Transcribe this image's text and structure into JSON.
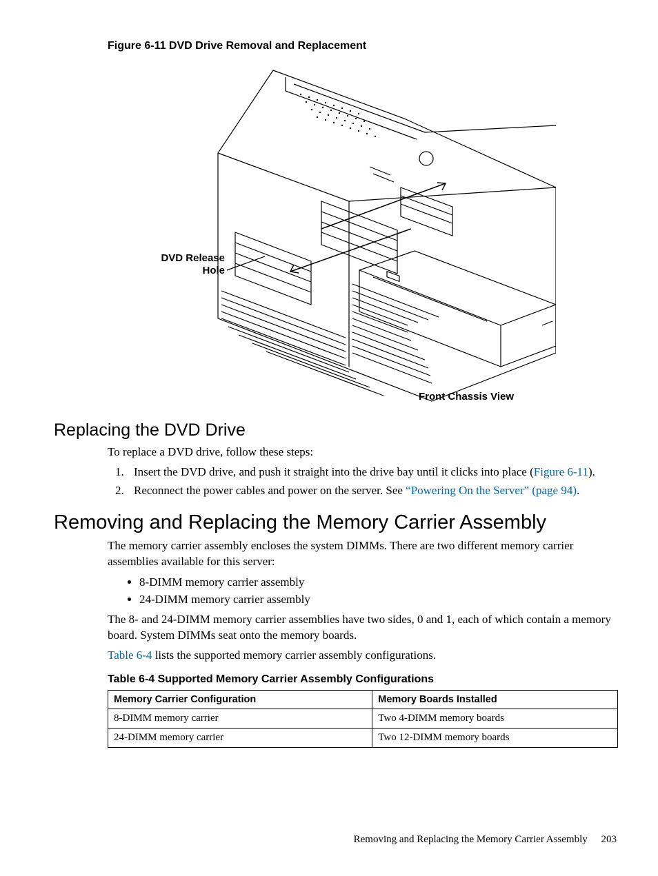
{
  "figure": {
    "caption": "Figure  6-11  DVD Drive Removal and Replacement",
    "label_left_line1": "DVD Release",
    "label_left_line2": "Hole",
    "label_bottom": "Front Chassis View"
  },
  "section_replace_dvd": {
    "heading": "Replacing the DVD Drive",
    "intro": "To replace a DVD drive, follow these steps:",
    "steps": [
      {
        "pre": "Insert the DVD drive, and push it straight into the drive bay until it clicks into place (",
        "link": "Figure 6-11",
        "post": ")."
      },
      {
        "pre": "Reconnect the power cables and power on the server. See ",
        "link": "“Powering On the Server” (page 94)",
        "post": "."
      }
    ]
  },
  "section_memory": {
    "heading": "Removing and Replacing the Memory Carrier Assembly",
    "p1": "The memory carrier assembly encloses the system DIMMs. There are two different memory carrier assemblies available for this server:",
    "bullets": [
      "8-DIMM memory carrier assembly",
      "24-DIMM memory carrier assembly"
    ],
    "p2": "The 8- and 24-DIMM memory carrier assemblies have two sides, 0 and 1, each of which contain a memory board. System DIMMs seat onto the memory boards.",
    "p3_link": "Table 6-4",
    "p3_rest": " lists the supported memory carrier assembly configurations."
  },
  "table": {
    "caption": "Table  6-4  Supported Memory Carrier Assembly Configurations",
    "headers": [
      "Memory Carrier Configuration",
      "Memory Boards Installed"
    ],
    "rows": [
      [
        "8-DIMM memory carrier",
        "Two 4-DIMM memory boards"
      ],
      [
        "24-DIMM memory carrier",
        "Two 12-DIMM memory boards"
      ]
    ]
  },
  "footer": {
    "title": "Removing and Replacing the Memory Carrier Assembly",
    "page": "203"
  }
}
